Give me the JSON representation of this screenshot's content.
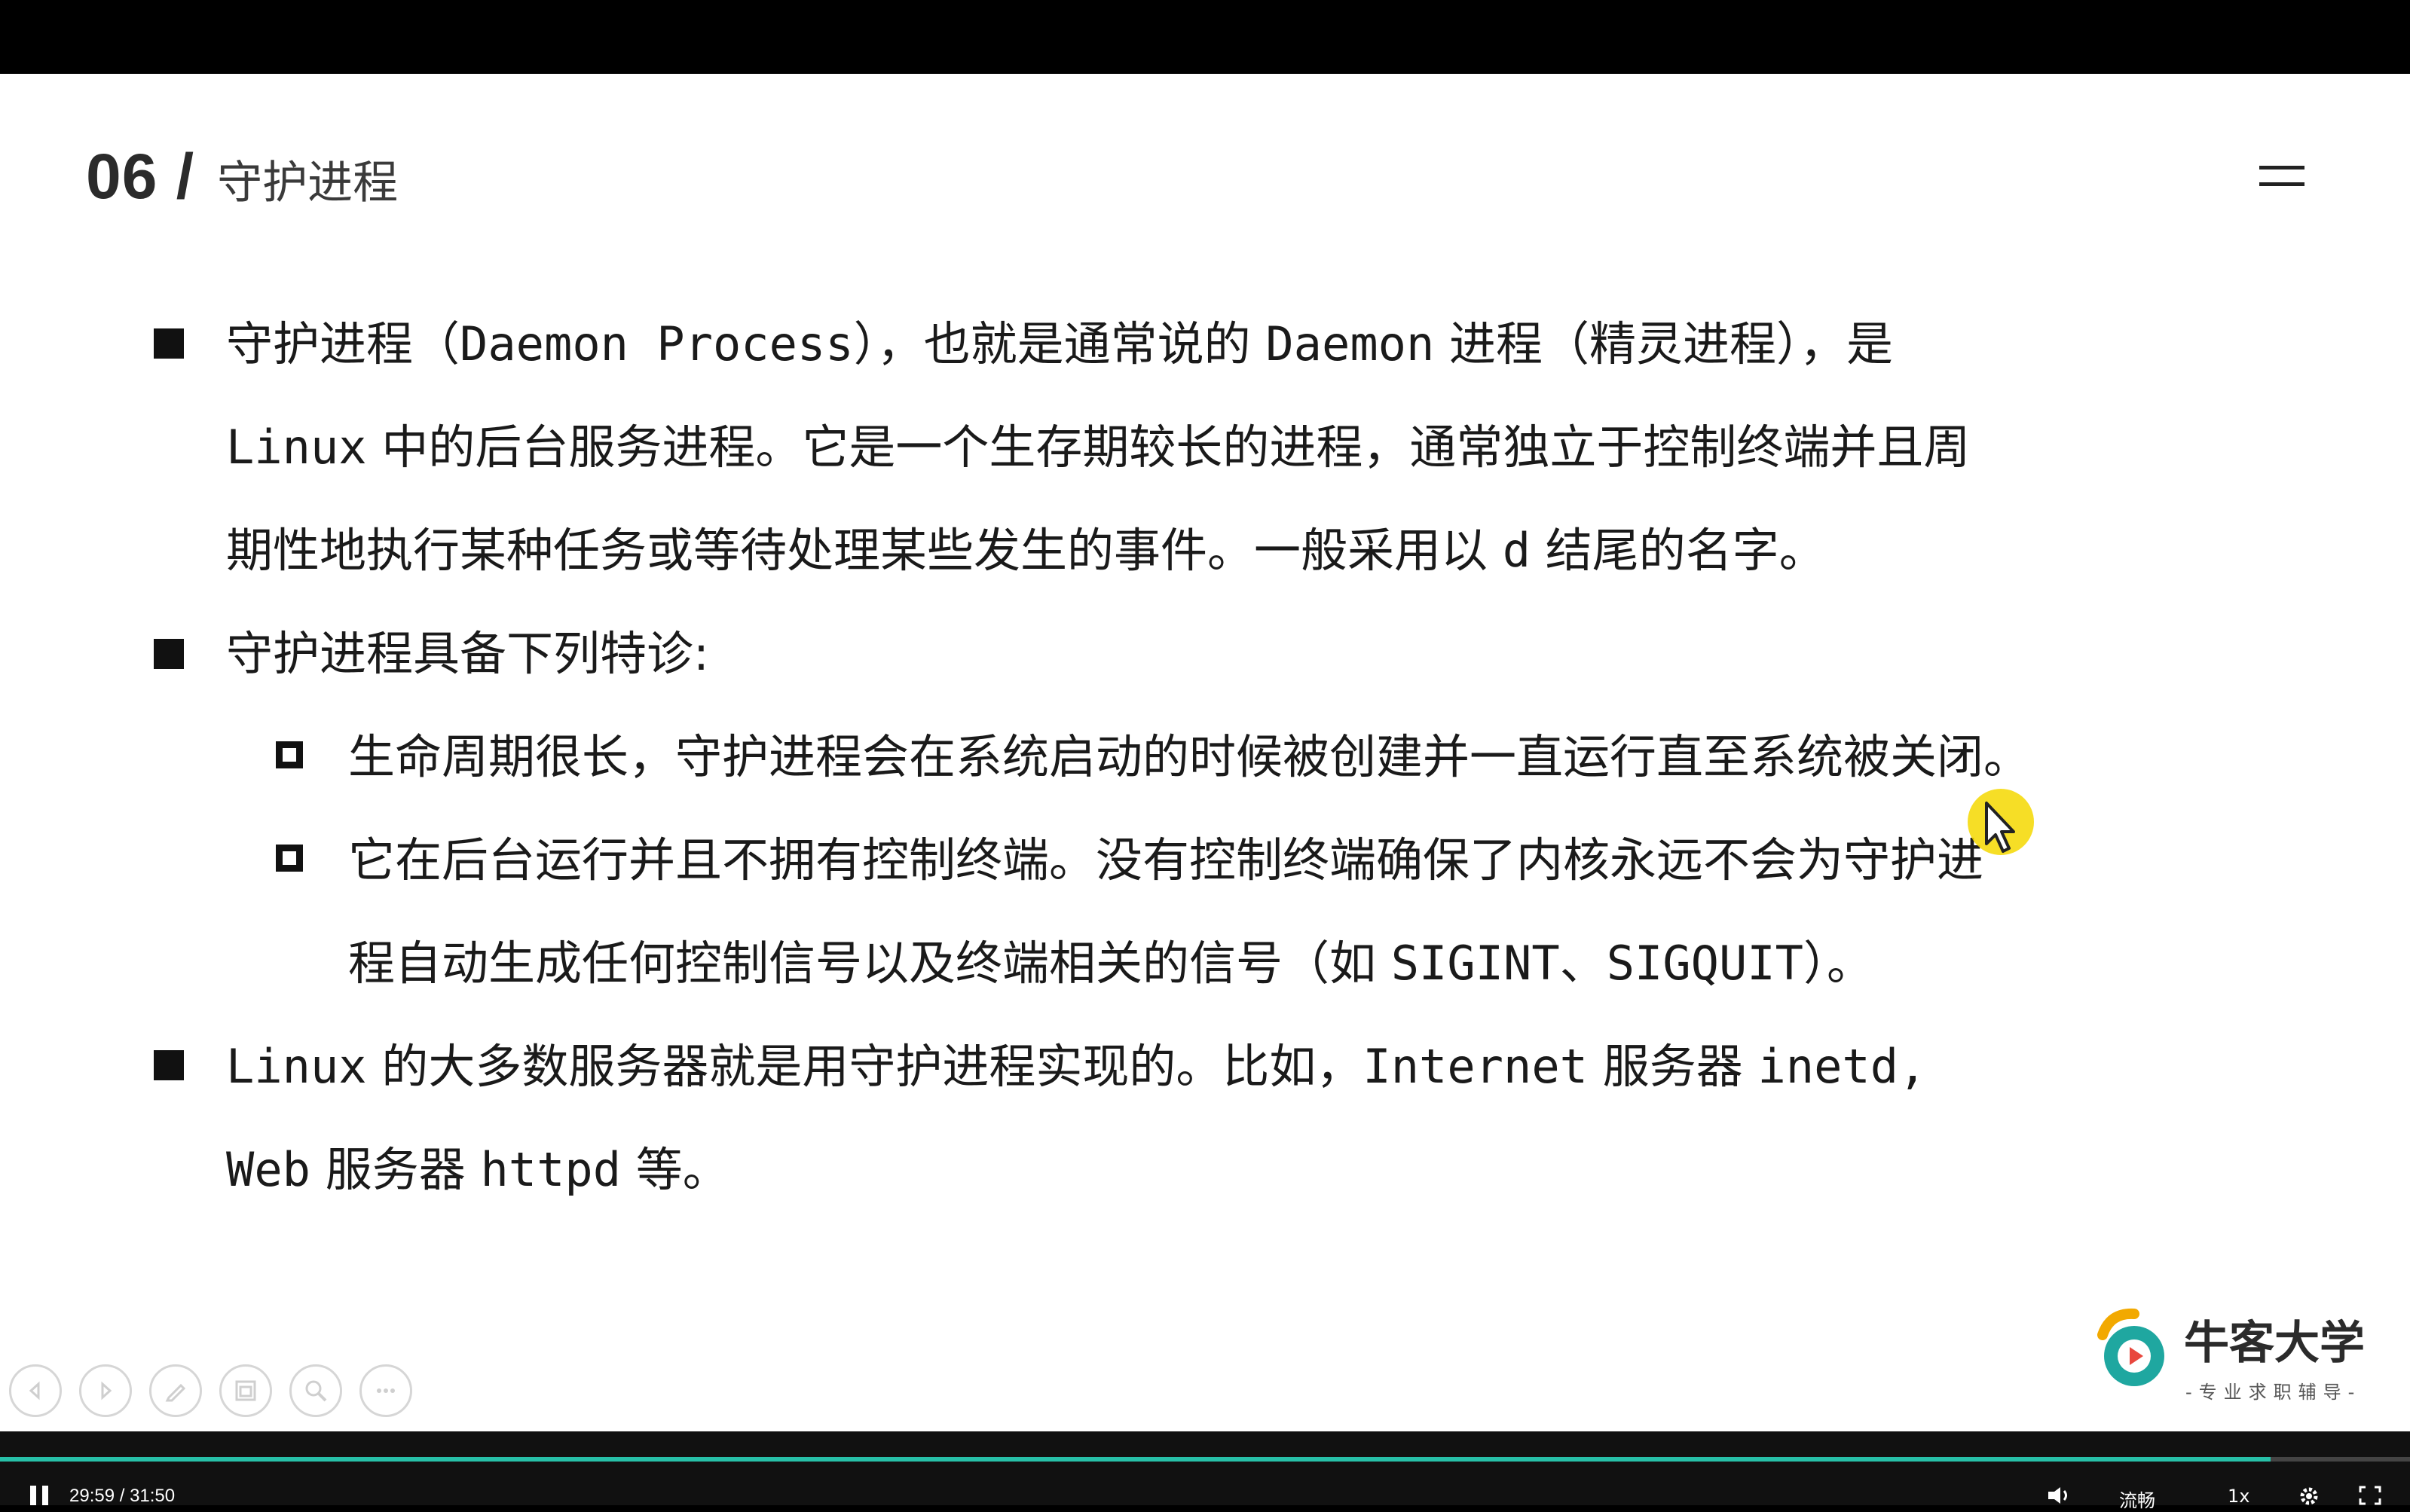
{
  "slide": {
    "number": "06 /",
    "subtitle": "守护进程"
  },
  "content": {
    "p1_l1_a": "守护进程（",
    "p1_l1_b": "Daemon Process",
    "p1_l1_c": "），也就是通常说的",
    "p1_l1_d": "Daemon",
    "p1_l1_e": "进程（精灵进程），是",
    "p1_l2_a": "Linux",
    "p1_l2_b": "中的后台服务进程。它是一个生存期较长的进程，通常独立于控制终端并且周",
    "p1_l3_a": "期性地执行某种任务或等待处理某些发生的事件。一般采用以",
    "p1_l3_b": "d",
    "p1_l3_c": "结尾的名字。",
    "p2": "守护进程具备下列特诊:",
    "s1": "生命周期很长，守护进程会在系统启动的时候被创建并一直运行直至系统被关闭。",
    "s2_l1": "它在后台运行并且不拥有控制终端。没有控制终端确保了内核永远不会为守护进",
    "s2_l2_a": "程自动生成任何控制信号以及终端相关的信号（如",
    "s2_l2_b": "SIGINT、SIGQUIT",
    "s2_l2_c": "）。",
    "p3_l1_a": "Linux",
    "p3_l1_b": "的大多数服务器就是用守护进程实现的。比如，",
    "p3_l1_c": "Internet",
    "p3_l1_d": "服务器",
    "p3_l1_e": "inetd,",
    "p3_l2_a": "Web",
    "p3_l2_b": "服务器",
    "p3_l2_c": "httpd",
    "p3_l2_d": "等。"
  },
  "logo": {
    "name": "牛客大学",
    "tagline": "-专业求职辅导-"
  },
  "toolbar": {
    "icons": [
      "prev-icon",
      "next-icon",
      "pen-icon",
      "slides-icon",
      "zoom-icon",
      "more-icon"
    ]
  },
  "player": {
    "time": "29:59 / 31:50",
    "quality": "流畅",
    "speed": "1x",
    "progress": 0.942,
    "accent": "#27c0a8"
  }
}
